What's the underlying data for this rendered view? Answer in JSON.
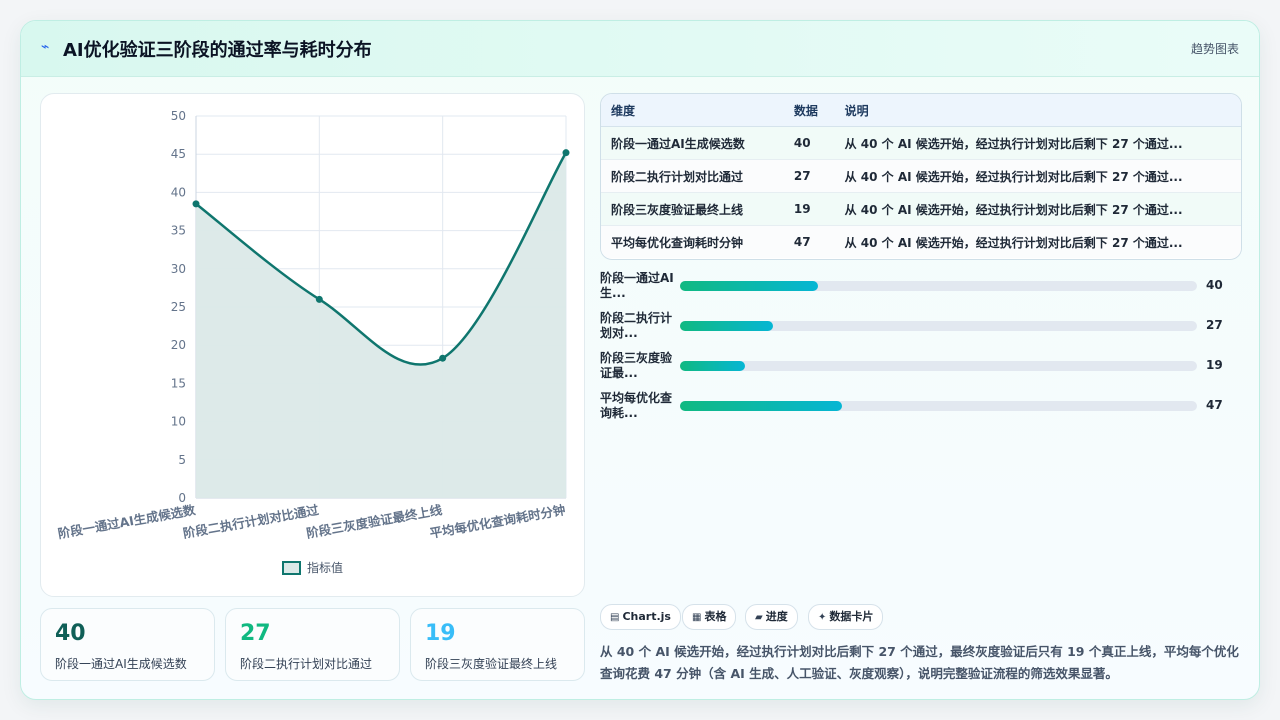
{
  "header": {
    "title_icon": "trend-icon",
    "title": "AI优化验证三阶段的通过率与耗时分布",
    "right_label": "趋势图表"
  },
  "chart_data": {
    "type": "area",
    "categories": [
      "阶段一通过AI生成候选数",
      "阶段二执行计划对比通过",
      "阶段三灰度验证最终上线",
      "平均每优化查询耗时分钟"
    ],
    "series": [
      {
        "name": "指标值",
        "values": [
          38.5,
          26,
          18.3,
          45.2
        ]
      }
    ],
    "ylim": [
      0,
      50
    ],
    "yticks": [
      0,
      5,
      10,
      15,
      20,
      25,
      30,
      35,
      40,
      45,
      50
    ],
    "grid": true,
    "legend_position": "bottom",
    "colors": {
      "line": "#0f766e",
      "fill": "#dbe9e8",
      "grid": "#e2e8f0",
      "tick": "#64748b"
    }
  },
  "kpis": [
    {
      "value": "40",
      "label": "阶段一通过AI生成候选数",
      "color": "#0f5f57"
    },
    {
      "value": "27",
      "label": "阶段二执行计划对比通过",
      "color": "#10b981"
    },
    {
      "value": "19",
      "label": "阶段三灰度验证最终上线",
      "color": "#38bdf8"
    }
  ],
  "table": {
    "headers": [
      "维度",
      "数据",
      "说明"
    ],
    "rows": [
      {
        "dim": "阶段一通过AI生成候选数",
        "value": "40",
        "desc": "从 40 个 AI 候选开始，经过执行计划对比后剩下 27 个通过..."
      },
      {
        "dim": "阶段二执行计划对比通过",
        "value": "27",
        "desc": "从 40 个 AI 候选开始，经过执行计划对比后剩下 27 个通过..."
      },
      {
        "dim": "阶段三灰度验证最终上线",
        "value": "19",
        "desc": "从 40 个 AI 候选开始，经过执行计划对比后剩下 27 个通过..."
      },
      {
        "dim": "平均每优化查询耗时分钟",
        "value": "47",
        "desc": "从 40 个 AI 候选开始，经过执行计划对比后剩下 27 个通过..."
      }
    ]
  },
  "bars": {
    "max": 150,
    "items": [
      {
        "label": "阶段一通过AI生...",
        "value": 40
      },
      {
        "label": "阶段二执行计划对...",
        "value": 27
      },
      {
        "label": "阶段三灰度验证最...",
        "value": 19
      },
      {
        "label": "平均每优化查询耗...",
        "value": 47
      }
    ]
  },
  "chips": [
    {
      "icon": "chart-icon",
      "glyph": "▤",
      "label": "Chart.js"
    },
    {
      "icon": "table-icon",
      "glyph": "▦",
      "label": "表格"
    },
    {
      "icon": "progress-icon",
      "glyph": "▰",
      "label": "进度"
    },
    {
      "icon": "sparkle-icon",
      "glyph": "✦",
      "label": "数据卡片"
    }
  ],
  "summary": "从 40 个 AI 候选开始，经过执行计划对比后剩下 27 个通过，最终灰度验证后只有 19 个真正上线，平均每个优化查询花费 47 分钟（含 AI 生成、人工验证、灰度观察），说明完整验证流程的筛选效果显著。"
}
